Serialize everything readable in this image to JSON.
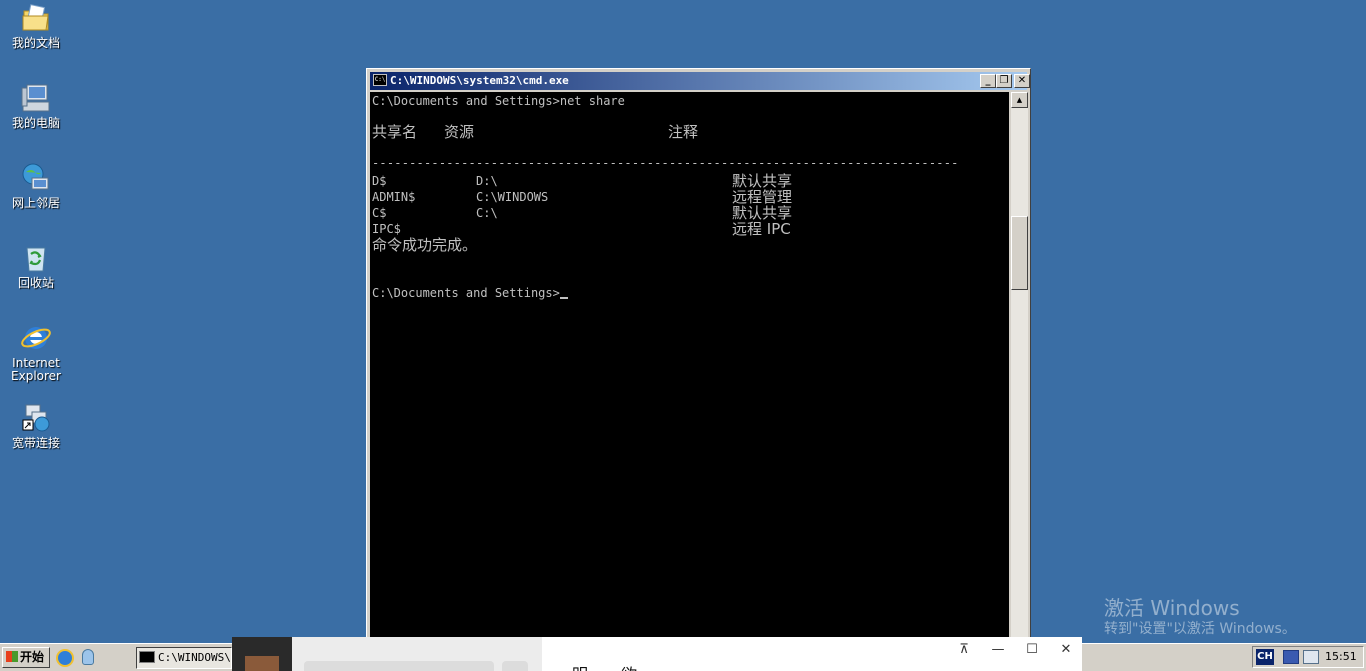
{
  "desktop": {
    "icons": [
      {
        "label": "我的文档"
      },
      {
        "label": "我的电脑"
      },
      {
        "label": "网上邻居"
      },
      {
        "label": "回收站"
      },
      {
        "label": "Internet\nExplorer"
      },
      {
        "label": "宽带连接"
      }
    ]
  },
  "window": {
    "title": "C:\\WINDOWS\\system32\\cmd.exe",
    "minimize": "_",
    "restore": "❐",
    "close": "✕",
    "console": {
      "command": "C:\\Documents and Settings>net share",
      "col_share": "共享名",
      "col_resource": "资源",
      "col_remark": "注释",
      "separator": "-------------------------------------------------------------------------------",
      "rows": [
        {
          "name": "D$",
          "resource": "D:\\",
          "remark": "默认共享"
        },
        {
          "name": "ADMIN$",
          "resource": "C:\\WINDOWS",
          "remark": "远程管理"
        },
        {
          "name": "C$",
          "resource": "C:\\",
          "remark": "默认共享"
        },
        {
          "name": "IPC$",
          "resource": "",
          "remark": "远程 IPC"
        }
      ],
      "success": "命令成功完成。",
      "prompt": "C:\\Documents and Settings>"
    }
  },
  "watermark": {
    "line1": "激活 Windows",
    "line2": "转到\"设置\"以激活 Windows。"
  },
  "taskbar": {
    "start": "开始",
    "task_label": "C:\\WINDOWS\\s",
    "overlay_heading": "明  欲",
    "overlay_pin": "⊼",
    "overlay_min": "—",
    "overlay_max": "☐",
    "overlay_close": "✕",
    "tray": {
      "ime": "CH",
      "clock": "15:51"
    }
  }
}
